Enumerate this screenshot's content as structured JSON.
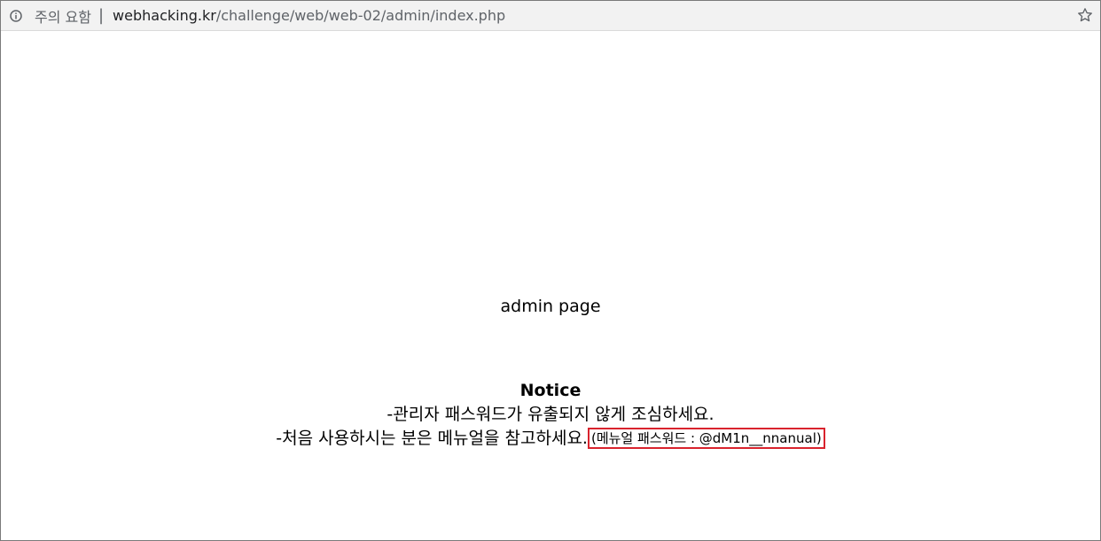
{
  "browser": {
    "security_label": "주의 요함",
    "separator": "|",
    "url_host": "webhacking.kr",
    "url_path": "/challenge/web/web-02/admin/index.php"
  },
  "page": {
    "title": "admin page",
    "notice_heading": "Notice",
    "notice_line1": "-관리자 패스워드가 유출되지 않게 조심하세요.",
    "notice_line2": "-처음 사용하시는 분은 메뉴얼을 참고하세요.",
    "manual_hint": "(메뉴얼 패스워드 : @dM1n__nnanual)"
  },
  "colors": {
    "highlight_border": "#d9232d"
  }
}
